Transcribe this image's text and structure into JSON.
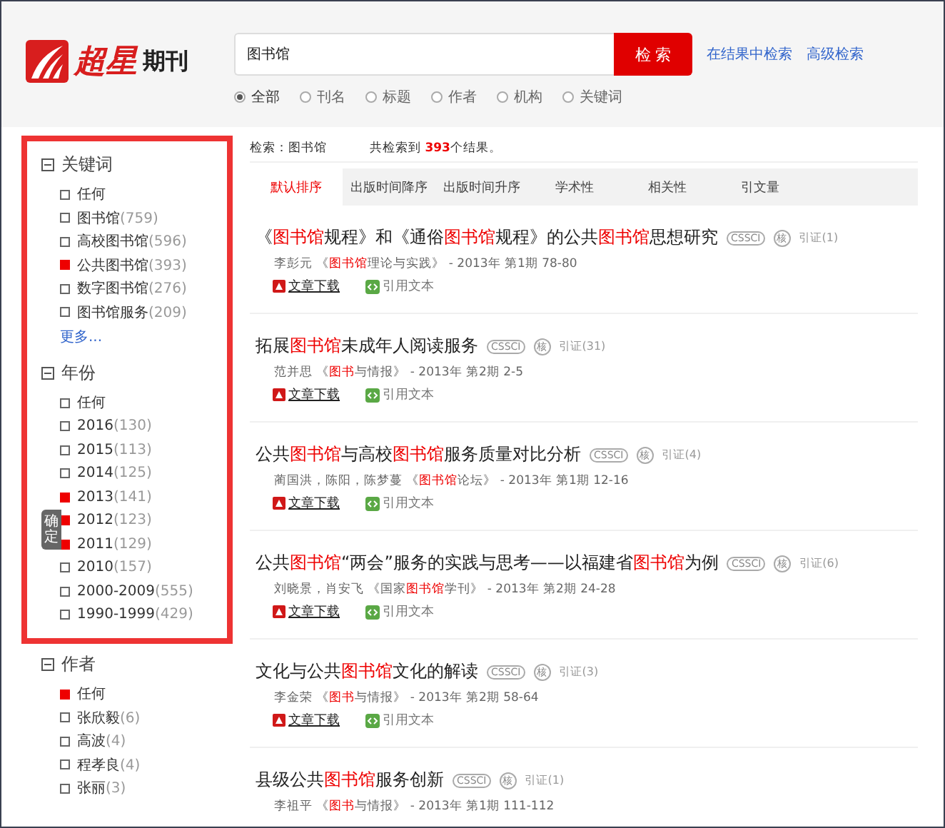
{
  "header": {
    "logo_mark": "超星",
    "logo_text": "期刊",
    "search": {
      "value": "图书馆"
    },
    "search_button": "检 索",
    "links": [
      "在结果中检索",
      "高级检索"
    ],
    "scopes": [
      {
        "label": "全部",
        "selected": true
      },
      {
        "label": "刊名",
        "selected": false
      },
      {
        "label": "标题",
        "selected": false
      },
      {
        "label": "作者",
        "selected": false
      },
      {
        "label": "机构",
        "selected": false
      },
      {
        "label": "关键词",
        "selected": false
      }
    ]
  },
  "sidebar": {
    "confirm_tab": "确定",
    "framed_sections": [
      {
        "title": "关键词",
        "expanded": true,
        "items": [
          {
            "label": "任何",
            "checked": false
          },
          {
            "label": "图书馆",
            "count": "(759)",
            "checked": false
          },
          {
            "label": "高校图书馆",
            "count": "(596)",
            "checked": false
          },
          {
            "label": "公共图书馆",
            "count": "(393)",
            "checked": true
          },
          {
            "label": "数字图书馆",
            "count": "(276)",
            "checked": false
          },
          {
            "label": "图书馆服务",
            "count": "(209)",
            "checked": false
          }
        ],
        "more": "更多..."
      },
      {
        "title": "年份",
        "expanded": true,
        "items": [
          {
            "label": "任何",
            "checked": false
          },
          {
            "label": "2016",
            "count": "(130)",
            "checked": false
          },
          {
            "label": "2015",
            "count": "(113)",
            "checked": false
          },
          {
            "label": "2014",
            "count": "(125)",
            "checked": false
          },
          {
            "label": "2013",
            "count": "(141)",
            "checked": true
          },
          {
            "label": "2012",
            "count": "(123)",
            "checked": true
          },
          {
            "label": "2011",
            "count": "(129)",
            "checked": true
          },
          {
            "label": "2010",
            "count": "(157)",
            "checked": false
          },
          {
            "label": "2000-2009",
            "count": "(555)",
            "checked": false
          },
          {
            "label": "1990-1999",
            "count": "(429)",
            "checked": false
          }
        ]
      }
    ],
    "sections": [
      {
        "title": "作者",
        "expanded": true,
        "items": [
          {
            "label": "任何",
            "checked": true
          },
          {
            "label": "张欣毅",
            "count": "(6)",
            "checked": false
          },
          {
            "label": "高波",
            "count": "(4)",
            "checked": false
          },
          {
            "label": "程孝良",
            "count": "(4)",
            "checked": false
          },
          {
            "label": "张丽",
            "count": "(3)",
            "checked": false
          }
        ]
      }
    ]
  },
  "results": {
    "query_label": "检索：图书馆",
    "summary": {
      "before": "共检索到 ",
      "count": "393",
      "after": "个结果。"
    },
    "sort_tabs": [
      {
        "label": "默认排序",
        "selected": true
      },
      {
        "label": "出版时间降序",
        "selected": false
      },
      {
        "label": "出版时间升序",
        "selected": false
      },
      {
        "label": "学术性",
        "selected": false
      },
      {
        "label": "相关性",
        "selected": false
      },
      {
        "label": "引文量",
        "selected": false
      }
    ],
    "items": [
      {
        "title": [
          {
            "text": "《",
            "hit": false
          },
          {
            "text": "图书馆",
            "hit": true
          },
          {
            "text": "规程》和《通俗",
            "hit": false
          },
          {
            "text": "图书馆",
            "hit": true
          },
          {
            "text": "规程》的公共",
            "hit": false
          },
          {
            "text": "图书馆",
            "hit": true
          },
          {
            "text": "思想研究",
            "hit": false
          }
        ],
        "cssci": "CSSCI",
        "core": "核",
        "citations": "引证(1)",
        "authors": "李彭元",
        "journal": [
          {
            "text": "《",
            "hit": false
          },
          {
            "text": "图书馆",
            "hit": true
          },
          {
            "text": "理论与实践》",
            "hit": false
          }
        ],
        "issue": "- 2013年 第1期 78-80",
        "download": "文章下载",
        "cite": "引用文本"
      },
      {
        "title": [
          {
            "text": "拓展",
            "hit": false
          },
          {
            "text": "图书馆",
            "hit": true
          },
          {
            "text": "未成年人阅读服务",
            "hit": false
          }
        ],
        "cssci": "CSSCI",
        "core": "核",
        "citations": "引证(31)",
        "authors": "范并思",
        "journal": [
          {
            "text": "《",
            "hit": false
          },
          {
            "text": "图书",
            "hit": true
          },
          {
            "text": "与情报》",
            "hit": false
          }
        ],
        "issue": "- 2013年 第2期 2-5",
        "download": "文章下载",
        "cite": "引用文本"
      },
      {
        "title": [
          {
            "text": "公共",
            "hit": false
          },
          {
            "text": "图书馆",
            "hit": true
          },
          {
            "text": "与高校",
            "hit": false
          },
          {
            "text": "图书馆",
            "hit": true
          },
          {
            "text": "服务质量对比分析",
            "hit": false
          }
        ],
        "cssci": "CSSCI",
        "core": "核",
        "citations": "引证(4)",
        "authors": "蔺国洪，陈阳，陈梦蔓",
        "journal": [
          {
            "text": "《",
            "hit": false
          },
          {
            "text": "图书馆",
            "hit": true
          },
          {
            "text": "论坛》",
            "hit": false
          }
        ],
        "issue": "- 2013年 第1期 12-16",
        "download": "文章下载",
        "cite": "引用文本"
      },
      {
        "title": [
          {
            "text": "公共",
            "hit": false
          },
          {
            "text": "图书馆",
            "hit": true
          },
          {
            "text": "“两会”服务的实践与思考——以福建省",
            "hit": false
          },
          {
            "text": "图书馆",
            "hit": true
          },
          {
            "text": "为例",
            "hit": false
          }
        ],
        "cssci": "CSSCI",
        "core": "核",
        "citations": "引证(6)",
        "authors": "刘晓景，肖安飞",
        "journal": [
          {
            "text": "《国家",
            "hit": false
          },
          {
            "text": "图书馆",
            "hit": true
          },
          {
            "text": "学刊》",
            "hit": false
          }
        ],
        "issue": "- 2013年 第2期 24-28",
        "download": "文章下载",
        "cite": "引用文本"
      },
      {
        "title": [
          {
            "text": "文化与公共",
            "hit": false
          },
          {
            "text": "图书馆",
            "hit": true
          },
          {
            "text": "文化的解读",
            "hit": false
          }
        ],
        "cssci": "CSSCI",
        "core": "核",
        "citations": "引证(3)",
        "authors": "李金荣",
        "journal": [
          {
            "text": "《",
            "hit": false
          },
          {
            "text": "图书",
            "hit": true
          },
          {
            "text": "与情报》",
            "hit": false
          }
        ],
        "issue": "- 2013年 第2期 58-64",
        "download": "文章下载",
        "cite": "引用文本"
      },
      {
        "title": [
          {
            "text": "县级公共",
            "hit": false
          },
          {
            "text": "图书馆",
            "hit": true
          },
          {
            "text": "服务创新",
            "hit": false
          }
        ],
        "cssci": "CSSCI",
        "core": "核",
        "citations": "引证(1)",
        "authors": "李祖平",
        "journal": [
          {
            "text": "《",
            "hit": false
          },
          {
            "text": "图书",
            "hit": true
          },
          {
            "text": "与情报》",
            "hit": false
          }
        ],
        "issue": "- 2013年 第1期 111-112"
      }
    ]
  }
}
